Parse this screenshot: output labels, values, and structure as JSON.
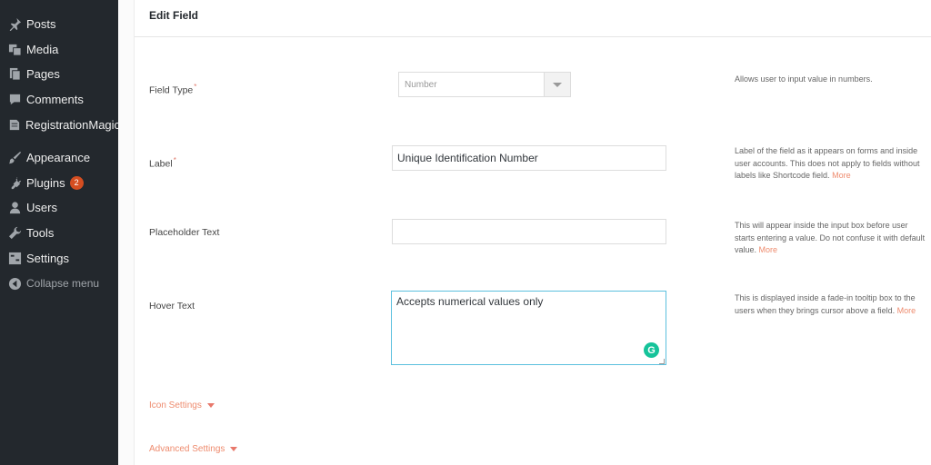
{
  "sidebar": {
    "items": [
      {
        "label": "Posts",
        "icon": "pin-icon"
      },
      {
        "label": "Media",
        "icon": "media-icon"
      },
      {
        "label": "Pages",
        "icon": "pages-icon"
      },
      {
        "label": "Comments",
        "icon": "comment-icon"
      },
      {
        "label": "RegistrationMagic",
        "icon": "registrationmagic-icon"
      },
      {
        "label": "Appearance",
        "icon": "brush-icon"
      },
      {
        "label": "Plugins",
        "icon": "plug-icon",
        "badge": "2"
      },
      {
        "label": "Users",
        "icon": "user-icon"
      },
      {
        "label": "Tools",
        "icon": "wrench-icon"
      },
      {
        "label": "Settings",
        "icon": "settings-icon"
      }
    ],
    "collapse_label": "Collapse menu"
  },
  "header": {
    "title": "Edit Field"
  },
  "form": {
    "field_type": {
      "label": "Field Type",
      "required_mark": "*",
      "value": "Number",
      "help": "Allows user to input value in numbers."
    },
    "label_field": {
      "label": "Label",
      "required_mark": "*",
      "value": "Unique Identification Number",
      "help": "Label of the field as it appears on forms and inside user accounts. This does not apply to fields without labels like Shortcode field.",
      "more": "More"
    },
    "placeholder": {
      "label": "Placeholder Text",
      "value": "",
      "help": "This will appear inside the input box before user starts entering a value. Do not confuse it with default value.",
      "more": "More"
    },
    "hover_text": {
      "label": "Hover Text",
      "value": "Accepts numerical values only",
      "help": "This is displayed inside a fade-in tooltip box to the users when they brings cursor above a field.",
      "more": "More"
    },
    "icon_settings": "Icon Settings",
    "advanced_settings": "Advanced Settings"
  },
  "colors": {
    "sidebar_bg": "#23282d",
    "accent_link": "#ee8b6e",
    "focus_border": "#5bc0de",
    "grammarly": "#15c39a",
    "badge": "#d54e21"
  }
}
